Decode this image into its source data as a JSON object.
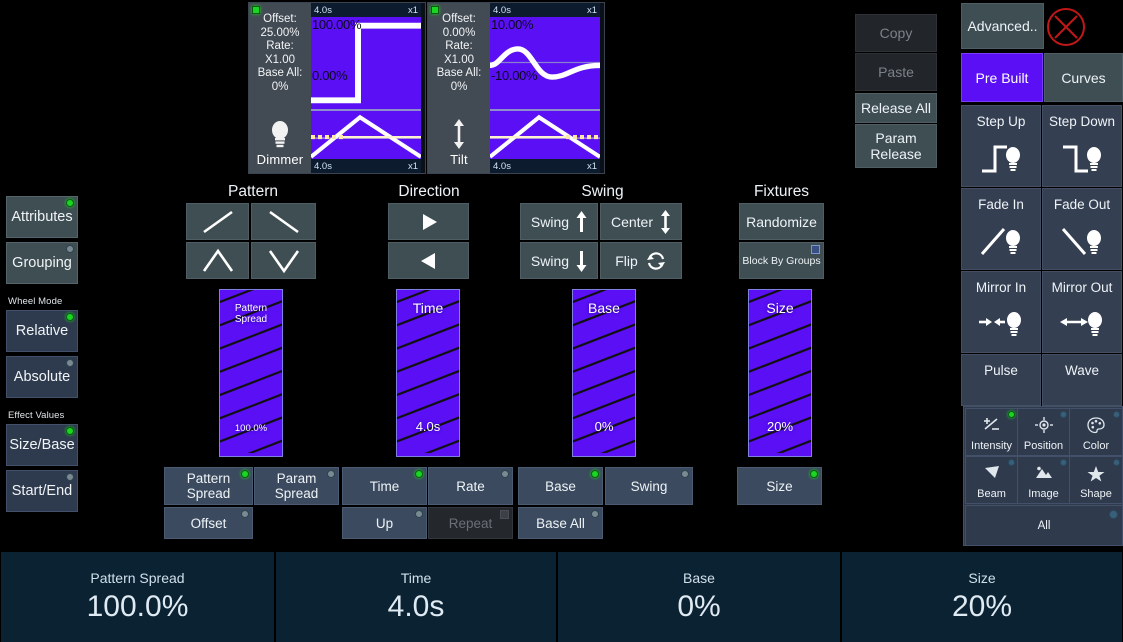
{
  "waveforms": [
    {
      "led": "on",
      "info_lines": [
        "Offset:",
        "25.00%",
        "Rate:",
        "X1.00",
        "Base All:",
        "0%"
      ],
      "icon": "lightbulb-icon",
      "icon_label": "Dimmer",
      "header_left": "4.0s",
      "header_right": "x1",
      "footer_left": "4.0s",
      "footer_right": "x1",
      "plot_top_label": "100.00%",
      "plot_bottom_label": "0.00%",
      "plot_shape": "step-up"
    },
    {
      "led": "on",
      "info_lines": [
        "Offset:",
        "0.00%",
        "Rate:",
        "X1.00",
        "Base All:",
        "0%"
      ],
      "icon": "updown-arrow-icon",
      "icon_label": "Tilt",
      "header_left": "4.0s",
      "header_right": "x1",
      "footer_left": "4.0s",
      "footer_right": "x1",
      "plot_top_label": "10.00%",
      "plot_bottom_label": "-10.00%",
      "plot_shape": "sine"
    }
  ],
  "sidebar": {
    "buttons": [
      {
        "label": "Attributes",
        "led": "on"
      },
      {
        "label": "Grouping",
        "led": "off"
      }
    ],
    "wheel_mode": {
      "group_label": "Wheel Mode",
      "options": [
        {
          "label": "Relative",
          "led": "on"
        },
        {
          "label": "Absolute",
          "led": "off"
        }
      ]
    },
    "effect_values": {
      "group_label": "Effect Values",
      "options": [
        {
          "label": "Size/Base",
          "led": "on"
        },
        {
          "label": "Start/End",
          "led": "off"
        }
      ]
    }
  },
  "groups": {
    "pattern": {
      "title": "Pattern",
      "buttons": [
        {
          "icon": "slope-up-icon"
        },
        {
          "icon": "slope-down-icon"
        },
        {
          "icon": "peak-icon"
        },
        {
          "icon": "valley-icon"
        }
      ]
    },
    "direction": {
      "title": "Direction",
      "buttons": [
        {
          "icon": "play-forward-icon"
        },
        {
          "icon": "play-reverse-icon"
        }
      ]
    },
    "swing": {
      "title": "Swing",
      "buttons": [
        {
          "label": "Swing",
          "icon": "arrow-up-icon"
        },
        {
          "label": "Center",
          "icon": "arrow-updown-icon"
        },
        {
          "label": "Swing",
          "icon": "arrow-down-icon"
        },
        {
          "label": "Flip",
          "icon": "refresh-cycle-icon"
        }
      ]
    },
    "fixtures": {
      "title": "Fixtures",
      "buttons": [
        {
          "label": "Randomize",
          "led": "none",
          "size": "normal"
        },
        {
          "label": "Block By Groups",
          "led": "square",
          "size": "small"
        }
      ]
    }
  },
  "sliders": [
    {
      "name": "Pattern Spread",
      "value": "100.0%",
      "small_name": true
    },
    {
      "name": "Time",
      "value": "4.0s",
      "small_name": false
    },
    {
      "name": "Base",
      "value": "0%",
      "small_name": false
    },
    {
      "name": "Size",
      "value": "20%",
      "small_name": false
    }
  ],
  "param_buttons_row1": [
    {
      "label": "Pattern\nSpread",
      "led": "on"
    },
    {
      "label": "Param\nSpread",
      "led": "off"
    },
    {
      "label": "Time",
      "led": "on"
    },
    {
      "label": "Rate",
      "led": "off"
    },
    {
      "label": "Base",
      "led": "on"
    },
    {
      "label": "Swing",
      "led": "off"
    },
    {
      "label": "Size",
      "led": "on"
    }
  ],
  "param_buttons_row2": [
    {
      "label": "Offset",
      "led": "off",
      "disabled": false
    },
    {
      "label": "Up",
      "led": "off",
      "disabled": false
    },
    {
      "label": "Repeat",
      "led": "off",
      "disabled": true
    },
    {
      "label": "Base All",
      "led": "off",
      "disabled": false
    }
  ],
  "right_panel": {
    "clipboard": [
      {
        "label": "Copy",
        "disabled": true
      },
      {
        "label": "Paste",
        "disabled": true
      },
      {
        "label": "Release All",
        "disabled": false
      },
      {
        "label": "Param\nRelease",
        "disabled": false
      }
    ],
    "advanced_label": "Advanced..",
    "close_icon": "close-circle-icon",
    "tabs": [
      {
        "label": "Pre Built",
        "active": true
      },
      {
        "label": "Curves",
        "active": false
      }
    ],
    "effects": [
      {
        "label": "Step Up",
        "icon": "step-up-icon"
      },
      {
        "label": "Step Down",
        "icon": "step-down-icon"
      },
      {
        "label": "Fade In",
        "icon": "fade-in-icon"
      },
      {
        "label": "Fade Out",
        "icon": "fade-out-icon"
      },
      {
        "label": "Mirror In",
        "icon": "mirror-in-icon"
      },
      {
        "label": "Mirror Out",
        "icon": "mirror-out-icon"
      },
      {
        "label": "Pulse",
        "icon": "pulse-icon"
      },
      {
        "label": "Wave",
        "icon": "wave-icon"
      }
    ],
    "attributes": [
      {
        "label": "Intensity",
        "icon": "intensity-icon",
        "led": "on"
      },
      {
        "label": "Position",
        "icon": "position-icon",
        "led": "off"
      },
      {
        "label": "Color",
        "icon": "color-palette-icon",
        "led": "off"
      },
      {
        "label": "Beam",
        "icon": "beam-icon",
        "led": "off"
      },
      {
        "label": "Image",
        "icon": "image-icon",
        "led": "off"
      },
      {
        "label": "Shape",
        "icon": "shape-star-icon",
        "led": "off"
      }
    ],
    "attributes_all_label": "All"
  },
  "encoders": [
    {
      "name": "Pattern Spread",
      "value": "100.0%"
    },
    {
      "name": "Time",
      "value": "4.0s"
    },
    {
      "name": "Base",
      "value": "0%"
    },
    {
      "name": "Size",
      "value": "20%"
    }
  ],
  "colors": {
    "accent_purple": "#5a0ff5",
    "panel_gray": "#3e4e53",
    "panel_blue": "#3b4a5e",
    "encoder_bg": "#0b2233",
    "led_on": "#1ad622",
    "led_off": "#7b8a92",
    "close_red": "#c01818"
  }
}
